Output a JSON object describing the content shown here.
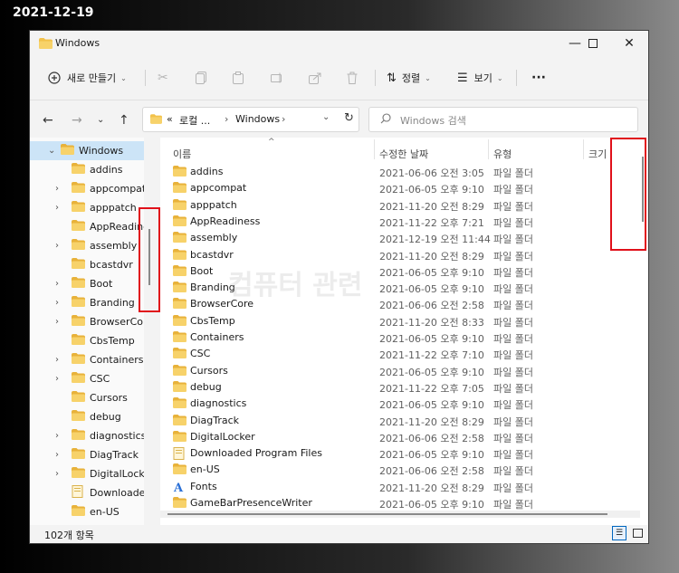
{
  "caption": "2021-12-19",
  "window": {
    "title": "Windows"
  },
  "commandbar": {
    "new_label": "새로 만들기",
    "sort_label": "정렬",
    "view_label": "보기",
    "more_label": "···"
  },
  "address": {
    "prefix": "«",
    "crumb1": "로컬 ...",
    "crumb2": "Windows"
  },
  "search": {
    "placeholder": "Windows 검색"
  },
  "tree": [
    {
      "label": "Windows",
      "expanded": true,
      "selected": true
    },
    {
      "label": "addins",
      "chevron": false
    },
    {
      "label": "appcompat",
      "chevron": true
    },
    {
      "label": "apppatch",
      "chevron": true
    },
    {
      "label": "AppReadiness",
      "chevron": false
    },
    {
      "label": "assembly",
      "chevron": true
    },
    {
      "label": "bcastdvr",
      "chevron": false
    },
    {
      "label": "Boot",
      "chevron": true
    },
    {
      "label": "Branding",
      "chevron": true
    },
    {
      "label": "BrowserCore",
      "chevron": true
    },
    {
      "label": "CbsTemp",
      "chevron": false
    },
    {
      "label": "Containers",
      "chevron": true
    },
    {
      "label": "CSC",
      "chevron": true
    },
    {
      "label": "Cursors",
      "chevron": false
    },
    {
      "label": "debug",
      "chevron": false
    },
    {
      "label": "diagnostics",
      "chevron": true
    },
    {
      "label": "DiagTrack",
      "chevron": true
    },
    {
      "label": "DigitalLocker",
      "chevron": true
    },
    {
      "label": "Downloaded",
      "chevron": false
    },
    {
      "label": "en-US",
      "chevron": false
    }
  ],
  "columns": {
    "name": "이름",
    "date": "수정한 날짜",
    "type": "유형",
    "size": "크기"
  },
  "files": [
    {
      "name": "addins",
      "date": "2021-06-06 오전 3:05",
      "type": "파일 폴더",
      "icon": "folder-icon"
    },
    {
      "name": "appcompat",
      "date": "2021-06-05 오후 9:10",
      "type": "파일 폴더",
      "icon": "folder-icon"
    },
    {
      "name": "apppatch",
      "date": "2021-11-20 오전 8:29",
      "type": "파일 폴더",
      "icon": "folder-icon"
    },
    {
      "name": "AppReadiness",
      "date": "2021-11-22 오후 7:21",
      "type": "파일 폴더",
      "icon": "folder-icon"
    },
    {
      "name": "assembly",
      "date": "2021-12-19 오전 11:44",
      "type": "파일 폴더",
      "icon": "folder-icon"
    },
    {
      "name": "bcastdvr",
      "date": "2021-11-20 오전 8:29",
      "type": "파일 폴더",
      "icon": "folder-icon"
    },
    {
      "name": "Boot",
      "date": "2021-06-05 오후 9:10",
      "type": "파일 폴더",
      "icon": "folder-icon"
    },
    {
      "name": "Branding",
      "date": "2021-06-05 오후 9:10",
      "type": "파일 폴더",
      "icon": "folder-icon"
    },
    {
      "name": "BrowserCore",
      "date": "2021-06-06 오전 2:58",
      "type": "파일 폴더",
      "icon": "folder-icon"
    },
    {
      "name": "CbsTemp",
      "date": "2021-11-20 오전 8:33",
      "type": "파일 폴더",
      "icon": "folder-icon"
    },
    {
      "name": "Containers",
      "date": "2021-06-05 오후 9:10",
      "type": "파일 폴더",
      "icon": "folder-icon"
    },
    {
      "name": "CSC",
      "date": "2021-11-22 오후 7:10",
      "type": "파일 폴더",
      "icon": "folder-icon"
    },
    {
      "name": "Cursors",
      "date": "2021-06-05 오후 9:10",
      "type": "파일 폴더",
      "icon": "folder-icon"
    },
    {
      "name": "debug",
      "date": "2021-11-22 오후 7:05",
      "type": "파일 폴더",
      "icon": "folder-icon"
    },
    {
      "name": "diagnostics",
      "date": "2021-06-05 오후 9:10",
      "type": "파일 폴더",
      "icon": "folder-icon"
    },
    {
      "name": "DiagTrack",
      "date": "2021-11-20 오전 8:29",
      "type": "파일 폴더",
      "icon": "folder-icon"
    },
    {
      "name": "DigitalLocker",
      "date": "2021-06-06 오전 2:58",
      "type": "파일 폴더",
      "icon": "folder-icon"
    },
    {
      "name": "Downloaded Program Files",
      "date": "2021-06-05 오후 9:10",
      "type": "파일 폴더",
      "icon": "special-folder-icon"
    },
    {
      "name": "en-US",
      "date": "2021-06-06 오전 2:58",
      "type": "파일 폴더",
      "icon": "folder-icon"
    },
    {
      "name": "Fonts",
      "date": "2021-11-20 오전 8:29",
      "type": "파일 폴더",
      "icon": "fonts-folder-icon"
    },
    {
      "name": "GameBarPresenceWriter",
      "date": "2021-06-05 오후 9:10",
      "type": "파일 폴더",
      "icon": "folder-icon"
    }
  ],
  "status": {
    "count": "102개 항목"
  },
  "watermark": "컴퓨터 관련",
  "colors": {
    "accent": "#0067c0",
    "highlight": "#e0101a",
    "folder": "#f2c14a"
  }
}
